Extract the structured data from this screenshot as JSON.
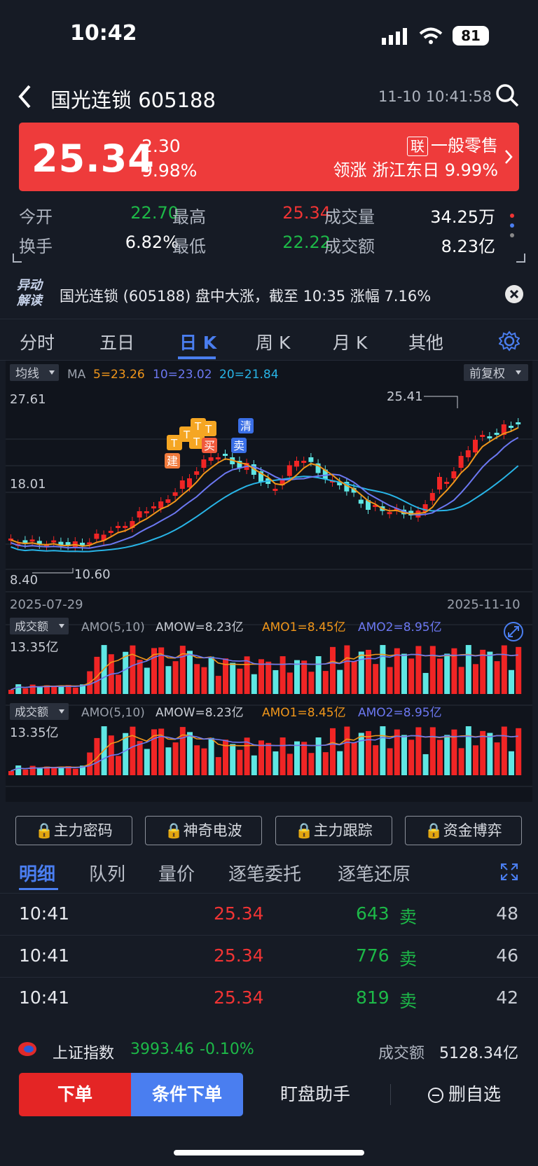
{
  "status": {
    "time": "10:42",
    "battery": "81"
  },
  "nav": {
    "title": "国光连锁 605188",
    "datetime": "11-10 10:41:58"
  },
  "quote": {
    "price": "25.34",
    "change": "2.30",
    "change_pct": "9.98%",
    "sector_tag": "联",
    "sector": "一般零售",
    "lead_text": "领涨 浙江东日 9.99%"
  },
  "stats": {
    "open_label": "今开",
    "open": "22.70",
    "high_label": "最高",
    "high": "25.34",
    "vol_label": "成交量",
    "vol": "34.25万",
    "turn_label": "换手",
    "turn": "6.82%",
    "low_label": "最低",
    "low": "22.22",
    "amt_label": "成交额",
    "amt": "8.23亿"
  },
  "news": {
    "badge_top": "异动",
    "badge_bottom": "解读",
    "text": "国光连锁 (605188) 盘中大涨，截至 10:35 涨幅 7.16%"
  },
  "tabs": [
    {
      "label": "分时"
    },
    {
      "label": "五日"
    },
    {
      "label": "日 K"
    },
    {
      "label": "周 K"
    },
    {
      "label": "月 K"
    },
    {
      "label": "其他"
    }
  ],
  "chart": {
    "ma_btn": "均线",
    "ma_label": "MA",
    "ma5": "5=23.26",
    "ma10": "10=23.02",
    "ma20": "20=21.84",
    "fq_btn": "前复权",
    "max_label": "25.41",
    "min_label": "10.60",
    "y_top": "27.61",
    "y_mid": "18.01",
    "y_bot": "8.40",
    "date_start": "2025-07-29",
    "date_end": "2025-11-10",
    "sig_jian": "建",
    "sig_t": "T",
    "sig_mai": "买",
    "sig_qing": "清",
    "sig_mai2": "卖",
    "amo_btn": "成交额",
    "amo_label": "AMO(5,10)",
    "amow": "AMOW=8.23亿",
    "amo1": "AMO1=8.45亿",
    "amo2": "AMO2=8.95亿",
    "amo_max": "13.35亿",
    "colors": {
      "up": "#f02525",
      "down": "#5fe7e4",
      "ma5": "#f0961a",
      "ma10": "#6c78f2",
      "ma20": "#28b4e6"
    }
  },
  "features": [
    {
      "label": "主力密码"
    },
    {
      "label": "神奇电波"
    },
    {
      "label": "主力跟踪"
    },
    {
      "label": "资金博弈"
    }
  ],
  "detail_tabs": [
    {
      "label": "明细"
    },
    {
      "label": "队列"
    },
    {
      "label": "量价"
    },
    {
      "label": "逐笔委托"
    },
    {
      "label": "逐笔还原"
    }
  ],
  "trades": [
    {
      "time": "10:41",
      "price": "25.34",
      "vol": "643",
      "side": "卖",
      "count": "48"
    },
    {
      "time": "10:41",
      "price": "25.34",
      "vol": "776",
      "side": "卖",
      "count": "46"
    },
    {
      "time": "10:41",
      "price": "25.34",
      "vol": "819",
      "side": "卖",
      "count": "42"
    }
  ],
  "index": {
    "name": "上证指数",
    "value": "3993.46",
    "change": "-0.10%",
    "amt_label": "成交额",
    "amt": "5128.34亿"
  },
  "actions": {
    "order": "下单",
    "cond_order": "条件下单",
    "assistant": "盯盘助手",
    "remove": "删自选"
  }
}
